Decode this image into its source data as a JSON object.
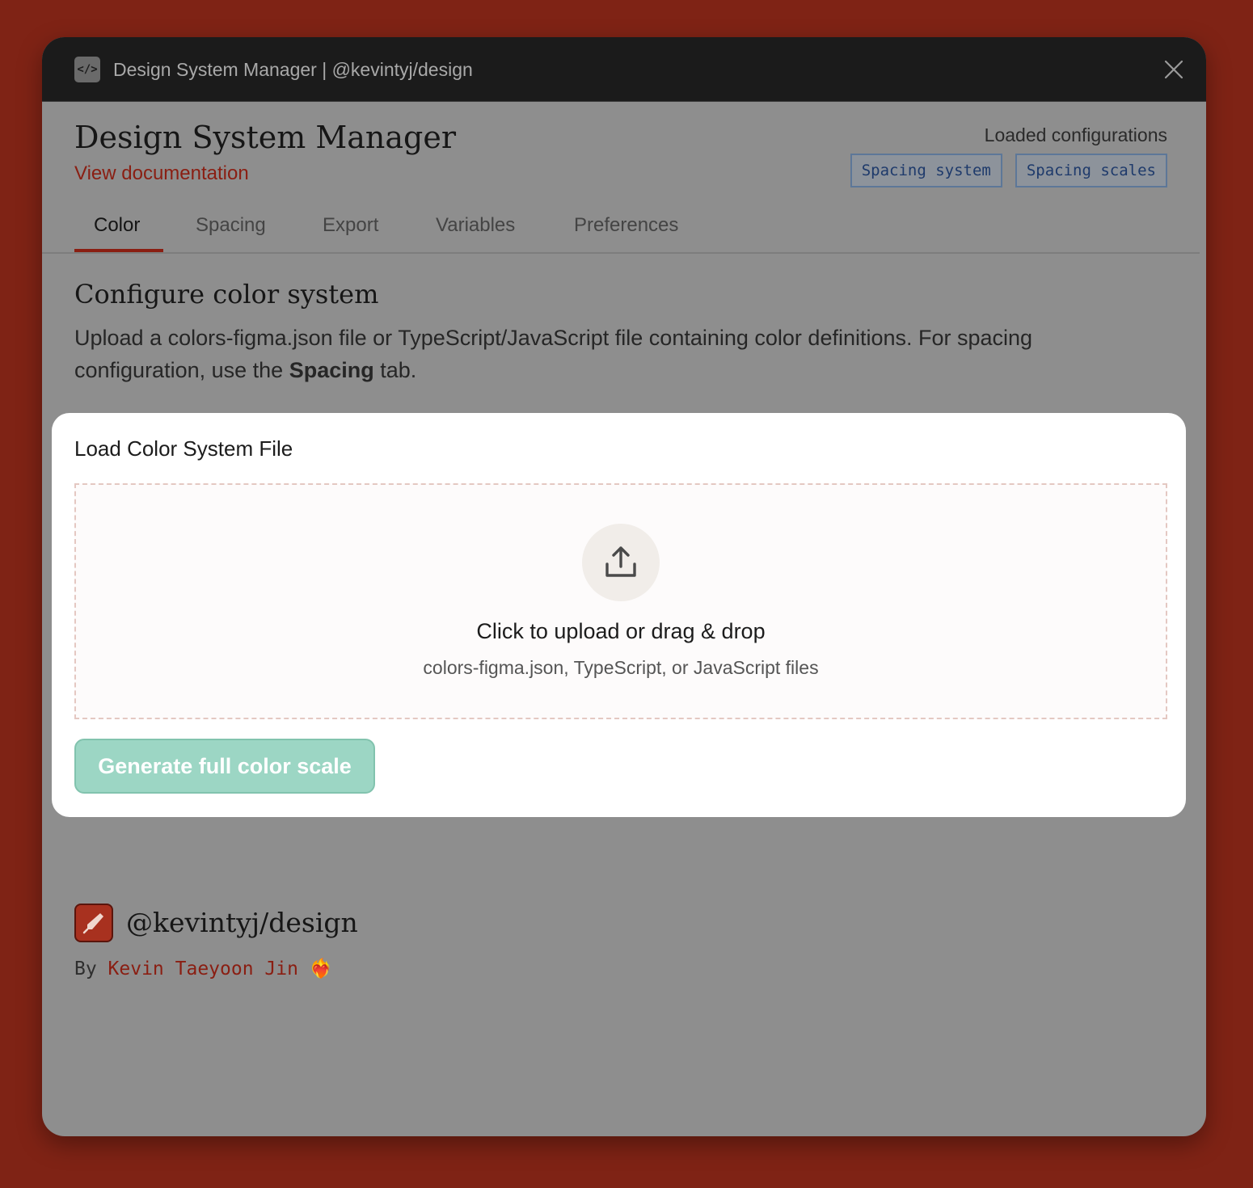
{
  "window": {
    "title": "Design System Manager | @kevintyj/design",
    "app_icon_glyph": "</>"
  },
  "header": {
    "app_title": "Design System Manager",
    "doc_link": "View documentation",
    "loaded_label": "Loaded configurations",
    "badges": [
      "Spacing system",
      "Spacing scales"
    ]
  },
  "tabs": [
    {
      "label": "Color",
      "active": true
    },
    {
      "label": "Spacing",
      "active": false
    },
    {
      "label": "Export",
      "active": false
    },
    {
      "label": "Variables",
      "active": false
    },
    {
      "label": "Preferences",
      "active": false
    }
  ],
  "section": {
    "title": "Configure color system",
    "desc_before": "Upload a colors-figma.json file or TypeScript/JavaScript file containing color definitions. For spacing configuration, use the ",
    "desc_bold": "Spacing",
    "desc_after": " tab."
  },
  "card": {
    "title": "Load Color System File",
    "drop_main": "Click to upload or drag & drop",
    "drop_sub": "colors-figma.json, TypeScript, or JavaScript files",
    "button": "Generate full color scale"
  },
  "footer": {
    "name": "@kevintyj/design",
    "by": "By ",
    "author": "Kevin Taeyoon Jin",
    "heart": "❤️‍🔥"
  },
  "colors": {
    "backdrop": "#7f2315",
    "accent": "#8a1e12",
    "button": "#9cd6c4",
    "badge_text": "#1e3a6b"
  }
}
